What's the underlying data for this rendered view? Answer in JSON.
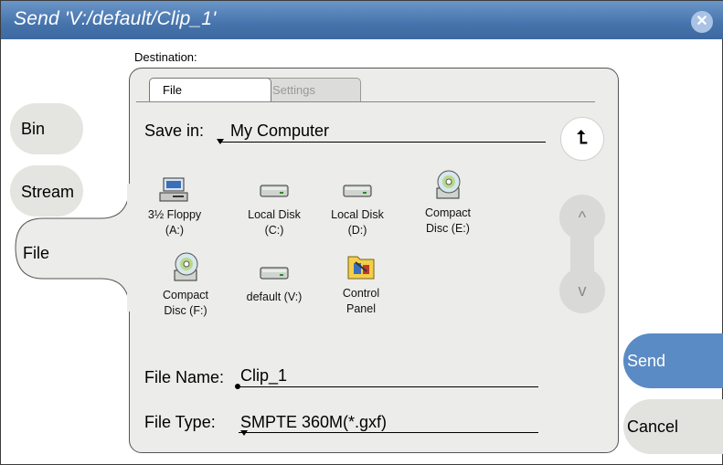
{
  "window": {
    "title": "Send 'V:/default/Clip_1'",
    "close_symbol": "✕"
  },
  "destination_label": "Destination:",
  "side_tabs": [
    {
      "label": "Bin"
    },
    {
      "label": "Stream"
    },
    {
      "label": "File",
      "selected": true
    }
  ],
  "tabs": [
    {
      "label": "File",
      "active": true
    },
    {
      "label": "Settings",
      "active": false
    }
  ],
  "save_in": {
    "label": "Save in:",
    "value": "My Computer"
  },
  "up_button_symbol": "⮤",
  "scroll": {
    "up_symbol": "^",
    "down_symbol": "v"
  },
  "items": [
    {
      "line1": "3½ Floppy",
      "line2": "(A:)",
      "icon": "floppy-drive-icon"
    },
    {
      "line1": "Local Disk",
      "line2": "(C:)",
      "icon": "hard-disk-icon"
    },
    {
      "line1": "Local Disk",
      "line2": "(D:)",
      "icon": "hard-disk-icon"
    },
    {
      "line1": "Compact",
      "line2": "Disc (E:)",
      "icon": "cd-drive-icon"
    },
    {
      "line1": "Compact",
      "line2": "Disc (F:)",
      "icon": "cd-drive-icon"
    },
    {
      "line1": "default (V:)",
      "line2": "",
      "icon": "hard-disk-icon"
    },
    {
      "line1": "Control",
      "line2": "Panel",
      "icon": "control-panel-icon"
    }
  ],
  "file_name": {
    "label": "File Name:",
    "value": "Clip_1"
  },
  "file_type": {
    "label": "File Type:",
    "value": "SMPTE 360M(*.gxf)"
  },
  "buttons": {
    "send": "Send",
    "cancel": "Cancel"
  },
  "colors": {
    "titlebar": "#4673ab",
    "send": "#5a8bc4",
    "panel": "#ececea"
  }
}
